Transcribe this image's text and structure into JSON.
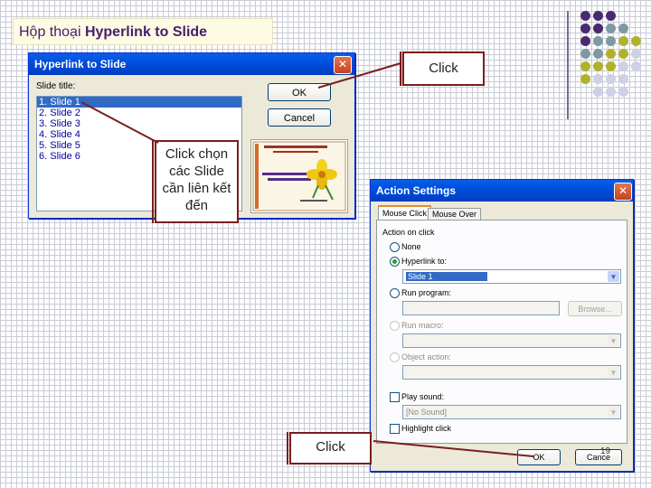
{
  "header": {
    "prefix": "Hộp thoại ",
    "bold": "Hyperlink to Slide"
  },
  "hyperlink_dialog": {
    "title": "Hyperlink to Slide",
    "close": "✕",
    "slide_title_label": "Slide title:",
    "slides": [
      "1. Slide 1",
      "2. Slide 2",
      "3. Slide 3",
      "4. Slide 4",
      "5. Slide 5",
      "6. Slide 6"
    ],
    "ok": "OK",
    "cancel": "Cancel"
  },
  "callouts": {
    "click_top": "Click",
    "click_choose": "Click chọn các Slide cần liên kết đến",
    "click_bottom": "Click"
  },
  "action_dialog": {
    "title": "Action Settings",
    "close": "✕",
    "tabs": [
      "Mouse Click",
      "Mouse Over"
    ],
    "action_on_click": "Action on click",
    "none": "None",
    "hyperlink_to": "Hyperlink to:",
    "hyperlink_value": "Slide 1",
    "run_program": "Run program:",
    "browse": "Browse...",
    "run_macro": "Run macro:",
    "object_action": "Object action:",
    "play_sound": "Play sound:",
    "sound_value": "[No Sound]",
    "highlight_click": "Highlight click",
    "ok": "OK",
    "cancel": "Cance"
  },
  "page_number": "19",
  "colors": {
    "purple": "#4a2a6e",
    "teal": "#7d9aa2",
    "olive": "#b2b12e",
    "lavender": "#cfcfe6"
  }
}
